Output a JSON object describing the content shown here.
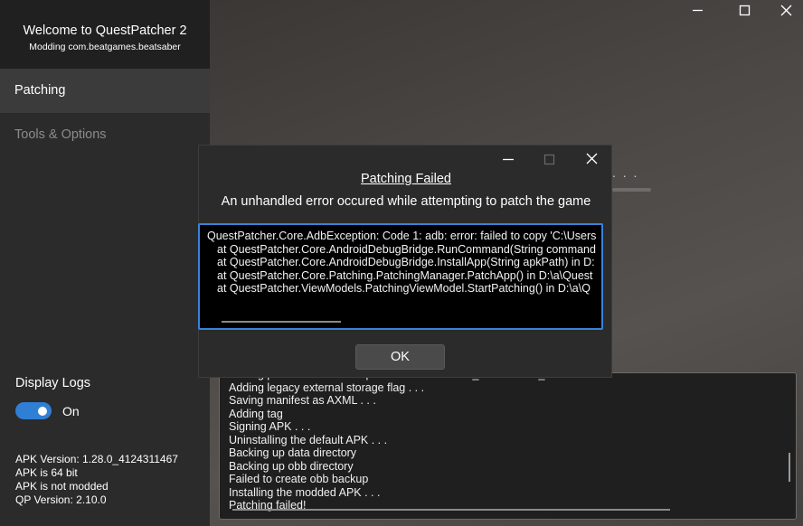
{
  "sidebar": {
    "title": "Welcome to QuestPatcher 2",
    "subtitle": "Modding com.beatgames.beatsaber",
    "nav": [
      {
        "label": "Patching",
        "active": true
      },
      {
        "label": "Tools & Options",
        "active": false
      }
    ],
    "display_logs_label": "Display Logs",
    "toggle_state_label": "On",
    "toggle_on": true,
    "info": [
      "APK Version: 1.28.0_4124311467",
      "APK is 64 bit",
      "APK is not modded",
      "QP Version: 2.10.0"
    ]
  },
  "main": {
    "progress_fragment": ". . .",
    "log_lines": [
      "Adding permission  android.permission.MANAGE_EXTERNAL_STORAGE",
      "Adding legacy external storage flag . . .",
      "Saving manifest as AXML . . .",
      "Adding tag",
      "Signing APK . . .",
      "Uninstalling the default APK . . .",
      "Backing up data directory",
      "Backing up obb directory",
      "Failed to create obb backup",
      "Installing the modded APK . . .",
      "Patching failed!"
    ]
  },
  "dialog": {
    "title": "Patching Failed",
    "message": "An unhandled error occured while attempting to patch the game",
    "error_lines": [
      "QuestPatcher.Core.AdbException: Code 1: adb: error: failed to copy 'C:\\Users",
      "at QuestPatcher.Core.AndroidDebugBridge.RunCommand(String command",
      "at QuestPatcher.Core.AndroidDebugBridge.InstallApp(String apkPath) in D:",
      "at QuestPatcher.Core.Patching.PatchingManager.PatchApp() in D:\\a\\Quest",
      "at QuestPatcher.ViewModels.PatchingViewModel.StartPatching() in D:\\a\\Q"
    ],
    "ok_label": "OK"
  },
  "colors": {
    "accent": "#2f7fd4",
    "sidebar_bg": "#2b2b2b",
    "header_bg": "#202020",
    "dialog_bg": "#2b2b2b",
    "error_box_bg": "#000000"
  }
}
